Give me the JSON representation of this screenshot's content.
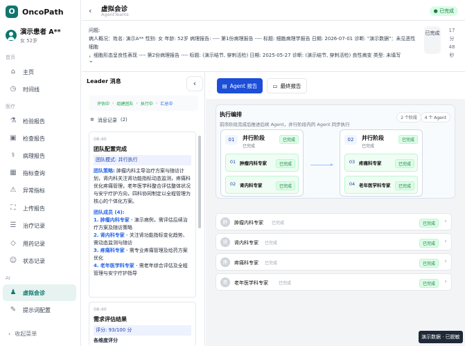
{
  "brand": {
    "logo": "O",
    "name": "OncoPath"
  },
  "patient": {
    "name": "演示患者 A**",
    "meta": "女 52岁"
  },
  "sidebar": {
    "section_home": "首页",
    "section_medical": "医疗",
    "section_ai": "AI",
    "items": [
      {
        "label": "主页",
        "icon": "home-icon",
        "glyph": "⌂"
      },
      {
        "label": "时间线",
        "icon": "clock-icon",
        "glyph": "◷"
      },
      {
        "label": "检验报告",
        "icon": "flask-icon",
        "glyph": "⚗"
      },
      {
        "label": "检查报告",
        "icon": "scan-icon",
        "glyph": "▣"
      },
      {
        "label": "病理报告",
        "icon": "microscope-icon",
        "glyph": "⚕"
      },
      {
        "label": "指标查询",
        "icon": "chart-icon",
        "glyph": "▦"
      },
      {
        "label": "异常指标",
        "icon": "alert-icon",
        "glyph": "⚠"
      },
      {
        "label": "上传报告",
        "icon": "image-icon",
        "glyph": "⛶"
      },
      {
        "label": "治疗记录",
        "icon": "clipboard-icon",
        "glyph": "☰"
      },
      {
        "label": "用药记录",
        "icon": "diamond-icon",
        "glyph": "◇"
      },
      {
        "label": "状态记录",
        "icon": "smile-icon",
        "glyph": "☺"
      },
      {
        "label": "虚拟会诊",
        "icon": "users-icon",
        "glyph": "♟"
      },
      {
        "label": "提示词配置",
        "icon": "edit-icon",
        "glyph": "✎"
      }
    ],
    "collapse": "收起菜单"
  },
  "header": {
    "title": "虚拟会诊",
    "subtitle": "AgentTeams",
    "status": "● 已完成"
  },
  "question": {
    "label": "问题:",
    "line1": "病人概况：姓名: 演示A** 性别: 女 年龄: 52岁 病理报告: ---- 第1份病理报告 ---- 标题: 细胞病理学报告 日期: 2026-07-01 诊断: \"演示数据\"：未见恶性细胞",
    "line2": "，细胞形态呈良性表现 ---- 第2份病理报告 ---- 标题: (演示结节, 穿刺活检) 日期: 2025-05-27 诊断: (演示结节, 穿刺活检) 良性病变 类型: 未填写",
    "badge": "已完成",
    "time": [
      "17",
      "分",
      "48",
      "秒"
    ],
    "expand": "⌄"
  },
  "leader": {
    "title": "Leader 消息",
    "collapse_glyph": "‹",
    "steps": [
      "评估中",
      "组建团队",
      "执行中",
      "汇总中"
    ],
    "records_label": "消息记录",
    "records_count": "(2)",
    "msg1": {
      "time": "08:40",
      "title": "团队配置完成",
      "mode": "团队模式: 并行执行",
      "strategy_label": "团队策略:",
      "strategy": "肿瘤内科主导治疗方案与随访计划，肾内科关注肾功能指标动态监测，疼痛科优化疼痛管理，老年医学科整合评估整体状况与安宁疗护方向，四科协同制定以全程管理为核心的个体化方案。",
      "members_label": "团队成员 (4):",
      "members": [
        {
          "num": "1.",
          "name": "肿瘤内科专家",
          "desc": " - 演示病例，需评估后续治疗方案及随访策略"
        },
        {
          "num": "2.",
          "name": "肾内科专家",
          "desc": " - 关注肾功能指标变化趋势、需动态监测与随访"
        },
        {
          "num": "3.",
          "name": "疼痛科专家",
          "desc": " - 需专业疼痛管理及给药方案优化"
        },
        {
          "num": "4.",
          "name": "老年医学科专家",
          "desc": " - 需老年综合评估及全程管理与安宁疗护指导"
        }
      ]
    },
    "msg2": {
      "time": "08:40",
      "title": "需求评估结果",
      "score": "评分: 93/100 分",
      "sub": "各维度评分"
    }
  },
  "tabs": [
    {
      "label": "Agent 报告",
      "icon": "agent-icon"
    },
    {
      "label": "最终报告",
      "icon": "document-icon"
    }
  ],
  "exec": {
    "title": "执行编排",
    "desc": "前序阶段完成后推进后续 Agent，并行阶段内的 Agent 同步执行",
    "pill_stages": "2 个阶段",
    "pill_agents": "4 个 Agent",
    "stages": [
      {
        "num": "01",
        "title": "并行阶段",
        "status": "已完成",
        "badge": "已完成",
        "agents": [
          {
            "num": "01",
            "name": "肿瘤内科专家",
            "badge": "已完成"
          },
          {
            "num": "02",
            "name": "肾内科专家",
            "badge": "已完成"
          }
        ]
      },
      {
        "num": "02",
        "title": "并行阶段",
        "status": "已完成",
        "badge": "已完成",
        "agents": [
          {
            "num": "03",
            "name": "疼痛科专家",
            "badge": "已完成"
          },
          {
            "num": "04",
            "name": "老年医学科专家",
            "badge": "已完成"
          }
        ]
      }
    ]
  },
  "agent_rows": [
    {
      "icon": "肿",
      "name": "肿瘤内科专家",
      "status": "已完成",
      "badge": "已完成"
    },
    {
      "icon": "肾",
      "name": "肾内科专家",
      "status": "已完成",
      "badge": "已完成"
    },
    {
      "icon": "疼",
      "name": "疼痛科专家",
      "status": "已完成",
      "badge": "已完成"
    },
    {
      "icon": "老",
      "name": "老年医学科专家",
      "status": "已完成",
      "badge": "已完成"
    }
  ],
  "toast": "演示数据 · 已脱敏",
  "colors": {
    "primary": "#0f766e",
    "accent": "#1d4ed8",
    "success": "#15803d"
  }
}
